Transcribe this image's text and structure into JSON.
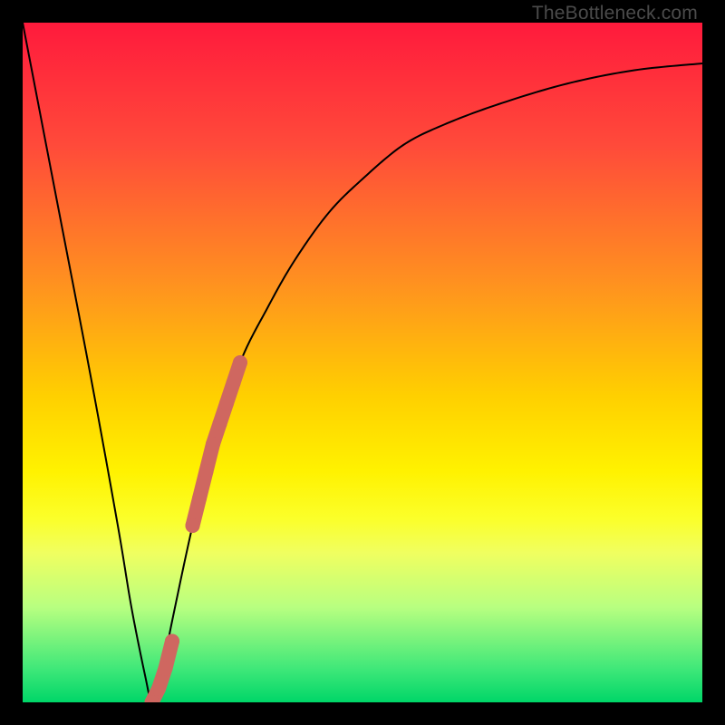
{
  "watermark": "TheBottleneck.com",
  "chart_data": {
    "type": "line",
    "title": "",
    "xlabel": "",
    "ylabel": "",
    "xlim": [
      0,
      100
    ],
    "ylim": [
      0,
      100
    ],
    "grid": false,
    "series": [
      {
        "name": "bottleneck-curve",
        "x": [
          0,
          5,
          10,
          14,
          16,
          18,
          19,
          20,
          22,
          25,
          28,
          32,
          36,
          40,
          45,
          50,
          56,
          62,
          70,
          80,
          90,
          100
        ],
        "y": [
          100,
          74,
          48,
          26,
          14,
          4,
          0,
          2,
          12,
          26,
          38,
          50,
          58,
          65,
          72,
          77,
          82,
          85,
          88,
          91,
          93,
          94
        ],
        "color": "#000000"
      }
    ],
    "markers": [
      {
        "name": "highlight-upper",
        "x": [
          25,
          26,
          27,
          28,
          29,
          30,
          31,
          32
        ],
        "y": [
          26,
          30,
          34,
          38,
          41,
          44,
          47,
          50
        ],
        "color": "#cf6760"
      },
      {
        "name": "highlight-lower",
        "x": [
          19,
          20,
          21,
          22
        ],
        "y": [
          0,
          2,
          5,
          9
        ],
        "color": "#cf6760"
      }
    ],
    "background_gradient": {
      "stops": [
        {
          "offset": 0.0,
          "color": "#ff1a3c"
        },
        {
          "offset": 0.18,
          "color": "#ff4a3a"
        },
        {
          "offset": 0.38,
          "color": "#ff9020"
        },
        {
          "offset": 0.55,
          "color": "#ffd000"
        },
        {
          "offset": 0.66,
          "color": "#fff200"
        },
        {
          "offset": 0.73,
          "color": "#fbff2a"
        },
        {
          "offset": 0.78,
          "color": "#f0ff60"
        },
        {
          "offset": 0.86,
          "color": "#b8ff80"
        },
        {
          "offset": 0.95,
          "color": "#40e879"
        },
        {
          "offset": 1.0,
          "color": "#00d668"
        }
      ]
    }
  }
}
